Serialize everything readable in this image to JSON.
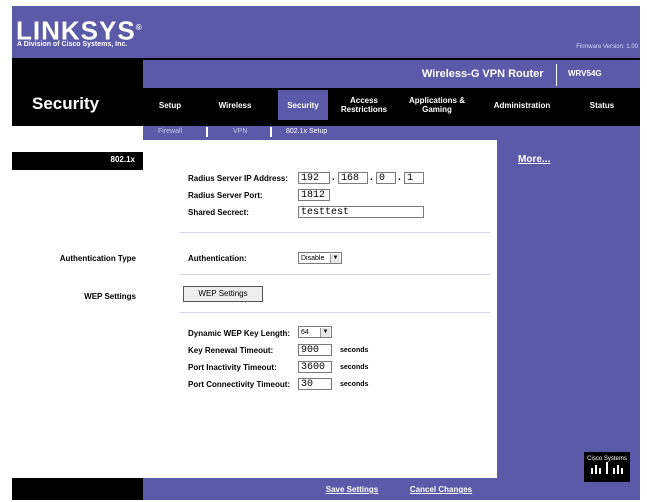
{
  "brand": {
    "logo": "LINKSYS",
    "logo_reg": "®",
    "subtitle": "A Division of Cisco Systems, Inc.",
    "firmware": "Firmware Version: 1.00"
  },
  "product": {
    "name": "Wireless-G VPN Router",
    "model": "WRV54G"
  },
  "section_title": "Security",
  "tabs": [
    {
      "label": "Setup"
    },
    {
      "label": "Wireless"
    },
    {
      "label": "Security"
    },
    {
      "label": "Access\nRestrictions"
    },
    {
      "label": "Applications &\nGaming"
    },
    {
      "label": "Administration"
    },
    {
      "label": "Status"
    }
  ],
  "subtabs": [
    {
      "label": "Firewall"
    },
    {
      "label": "VPN"
    },
    {
      "label": "802.1x Setup"
    }
  ],
  "left": {
    "header": "802.1x",
    "auth_type": "Authentication Type",
    "wep_settings": "WEP Settings"
  },
  "form": {
    "radius_ip_label": "Radius Server IP Address:",
    "radius_ip": [
      "192",
      "168",
      "0",
      "1"
    ],
    "radius_port_label": "Radius Server Port:",
    "radius_port": "1812",
    "shared_secret_label": "Shared Secrect:",
    "shared_secret": "testtest",
    "authentication_label": "Authentication:",
    "authentication_value": "Disable",
    "wep_button": "WEP Settings",
    "wep_key_length_label": "Dynamic WEP Key Length:",
    "wep_key_length_value": "64",
    "key_renewal_label": "Key Renewal Timeout:",
    "key_renewal_value": "900",
    "port_inactivity_label": "Port Inactivity Timeout:",
    "port_inactivity_value": "3600",
    "port_connectivity_label": "Port Connectivity Timeout:",
    "port_connectivity_value": "30",
    "seconds": "seconds"
  },
  "more": "More...",
  "footer": {
    "save": "Save Settings",
    "cancel": "Cancel Changes"
  },
  "cisco": "Cisco Systems",
  "colors": {
    "accent": "#5a5aa8",
    "dark": "#000000"
  }
}
